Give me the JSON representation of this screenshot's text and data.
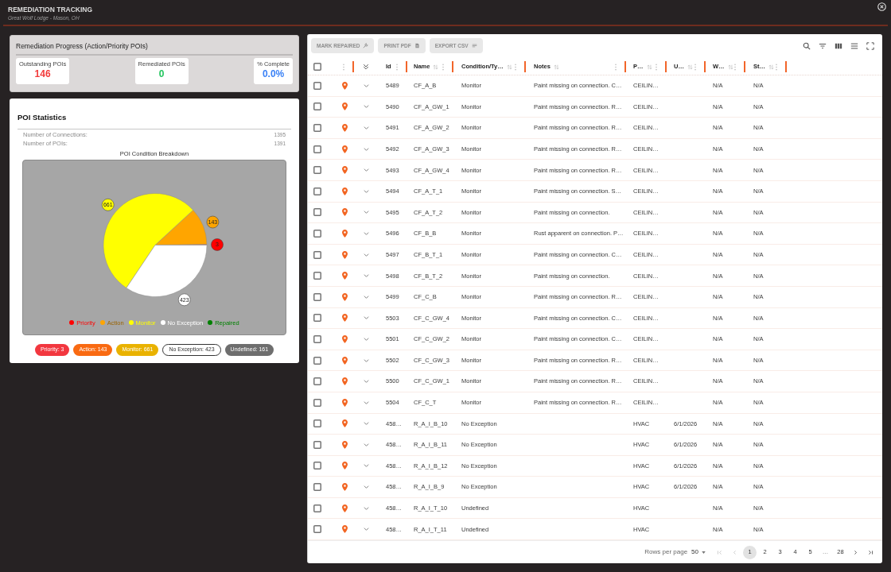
{
  "header": {
    "title": "REMEDIATION TRACKING",
    "subtitle": "Great Wolf Lodge - Mason, OH"
  },
  "progress_panel": {
    "title": "Remediation Progress (Action/Priority POIs)",
    "stats": [
      {
        "label": "Outstanding POIs",
        "value": "146",
        "color": "#f23b3b"
      },
      {
        "label": "Remediated POIs",
        "value": "0",
        "color": "#22c55e"
      },
      {
        "label": "% Complete",
        "value": "0.0%",
        "color": "#3b82f6"
      }
    ]
  },
  "statistics_panel": {
    "title": "POI Statistics",
    "rows": [
      {
        "label": "Number of Connections:",
        "value": "1395"
      },
      {
        "label": "Number of POIs:",
        "value": "1391"
      }
    ],
    "chart_data": {
      "type": "pie",
      "title": "POI Condition Breakdown",
      "categories": [
        "Priority",
        "Action",
        "Monitor",
        "No Exception",
        "Repaired"
      ],
      "values": [
        3,
        143,
        661,
        423,
        0
      ],
      "colors": [
        "#ff0000",
        "#ffa500",
        "#ffff00",
        "#ffffff",
        "#008000"
      ],
      "data_labels": true,
      "legend": "bottom"
    },
    "badges": [
      {
        "label": "Priority: 3",
        "kind": "filled",
        "color": "#f2373f"
      },
      {
        "label": "Action: 143",
        "kind": "filled",
        "color": "#f96a12"
      },
      {
        "label": "Monitor: 661",
        "kind": "filled",
        "color": "#e9b200"
      },
      {
        "label": "No Exception: 423",
        "kind": "outlined",
        "color": "#ffffff"
      },
      {
        "label": "Undefined: 161",
        "kind": "filled",
        "color": "#6e6e6e"
      }
    ]
  },
  "toolbar": {
    "buttons": [
      {
        "label": "MARK REPAIRED",
        "disabled": true
      },
      {
        "label": "PRINT PDF",
        "disabled": true
      },
      {
        "label": "EXPORT CSV",
        "disabled": true
      }
    ]
  },
  "table": {
    "all_checked": false,
    "columns": [
      {
        "label": "Id",
        "sortable": false
      },
      {
        "label": "Name",
        "sortable": true
      },
      {
        "label": "Condition/Ty…",
        "sortable": true
      },
      {
        "label": "Notes",
        "sortable": true
      },
      {
        "label": "P…",
        "sortable": true
      },
      {
        "label": "U…",
        "sortable": true
      },
      {
        "label": "W…",
        "sortable": true
      },
      {
        "label": "St…",
        "sortable": true
      }
    ],
    "rows": [
      {
        "checked": false,
        "expanded": false,
        "id": "5489",
        "name": "CF_A_B",
        "condition": "Monitor",
        "notes": "Paint missing on connection. C…",
        "column_5": "CEILIN…",
        "column_7": "N/A",
        "column_8": "N/A"
      },
      {
        "checked": false,
        "expanded": false,
        "id": "5490",
        "name": "CF_A_GW_1",
        "condition": "Monitor",
        "notes": "Paint missing on connection. R…",
        "column_5": "CEILIN…",
        "column_7": "N/A",
        "column_8": "N/A"
      },
      {
        "checked": false,
        "expanded": false,
        "id": "5491",
        "name": "CF_A_GW_2",
        "condition": "Monitor",
        "notes": "Paint missing on connection. R…",
        "column_5": "CEILIN…",
        "column_7": "N/A",
        "column_8": "N/A"
      },
      {
        "checked": false,
        "expanded": false,
        "id": "5492",
        "name": "CF_A_GW_3",
        "condition": "Monitor",
        "notes": "Paint missing on connection. R…",
        "column_5": "CEILIN…",
        "column_7": "N/A",
        "column_8": "N/A"
      },
      {
        "checked": false,
        "expanded": false,
        "id": "5493",
        "name": "CF_A_GW_4",
        "condition": "Monitor",
        "notes": "Paint missing on connection. R…",
        "column_5": "CEILIN…",
        "column_7": "N/A",
        "column_8": "N/A"
      },
      {
        "checked": false,
        "expanded": false,
        "id": "5494",
        "name": "CF_A_T_1",
        "condition": "Monitor",
        "notes": "Paint missing on connection. S…",
        "column_5": "CEILIN…",
        "column_7": "N/A",
        "column_8": "N/A"
      },
      {
        "checked": false,
        "expanded": false,
        "id": "5495",
        "name": "CF_A_T_2",
        "condition": "Monitor",
        "notes": "Paint missing on connection.",
        "column_5": "CEILIN…",
        "column_7": "N/A",
        "column_8": "N/A"
      },
      {
        "checked": false,
        "expanded": false,
        "id": "5496",
        "name": "CF_B_B",
        "condition": "Monitor",
        "notes": "Rust apparent on connection. P…",
        "column_5": "CEILIN…",
        "column_7": "N/A",
        "column_8": "N/A"
      },
      {
        "checked": false,
        "expanded": false,
        "id": "5497",
        "name": "CF_B_T_1",
        "condition": "Monitor",
        "notes": "Paint missing on connection. C…",
        "column_5": "CEILIN…",
        "column_7": "N/A",
        "column_8": "N/A"
      },
      {
        "checked": false,
        "expanded": false,
        "id": "5498",
        "name": "CF_B_T_2",
        "condition": "Monitor",
        "notes": "Paint missing on connection.",
        "column_5": "CEILIN…",
        "column_7": "N/A",
        "column_8": "N/A"
      },
      {
        "checked": false,
        "expanded": false,
        "id": "5499",
        "name": "CF_C_B",
        "condition": "Monitor",
        "notes": "Paint missing on connection. R…",
        "column_5": "CEILIN…",
        "column_7": "N/A",
        "column_8": "N/A"
      },
      {
        "checked": false,
        "expanded": false,
        "id": "5503",
        "name": "CF_C_GW_4",
        "condition": "Monitor",
        "notes": "Paint missing on connection. C…",
        "column_5": "CEILIN…",
        "column_7": "N/A",
        "column_8": "N/A"
      },
      {
        "checked": false,
        "expanded": false,
        "id": "5501",
        "name": "CF_C_GW_2",
        "condition": "Monitor",
        "notes": "Paint missing on connection. C…",
        "column_5": "CEILIN…",
        "column_7": "N/A",
        "column_8": "N/A"
      },
      {
        "checked": false,
        "expanded": false,
        "id": "5502",
        "name": "CF_C_GW_3",
        "condition": "Monitor",
        "notes": "Paint missing on connection. R…",
        "column_5": "CEILIN…",
        "column_7": "N/A",
        "column_8": "N/A"
      },
      {
        "checked": false,
        "expanded": false,
        "id": "5500",
        "name": "CF_C_GW_1",
        "condition": "Monitor",
        "notes": "Paint missing on connection. R…",
        "column_5": "CEILIN…",
        "column_7": "N/A",
        "column_8": "N/A"
      },
      {
        "checked": false,
        "expanded": false,
        "id": "5504",
        "name": "CF_C_T",
        "condition": "Monitor",
        "notes": "Paint missing on connection. R…",
        "column_5": "CEILIN…",
        "column_7": "N/A",
        "column_8": "N/A"
      },
      {
        "checked": false,
        "expanded": false,
        "id": "458…",
        "name": "R_A_I_B_10",
        "condition": "No Exception",
        "column_5": "HVAC",
        "column_6": "6/1/2026",
        "column_7": "N/A",
        "column_8": "N/A"
      },
      {
        "checked": false,
        "expanded": false,
        "id": "458…",
        "name": "R_A_I_B_11",
        "condition": "No Exception",
        "column_5": "HVAC",
        "column_6": "6/1/2026",
        "column_7": "N/A",
        "column_8": "N/A"
      },
      {
        "checked": false,
        "expanded": false,
        "id": "458…",
        "name": "R_A_I_B_12",
        "condition": "No Exception",
        "column_5": "HVAC",
        "column_6": "6/1/2026",
        "column_7": "N/A",
        "column_8": "N/A"
      },
      {
        "checked": false,
        "expanded": false,
        "id": "458…",
        "name": "R_A_I_B_9",
        "condition": "No Exception",
        "column_5": "HVAC",
        "column_6": "6/1/2026",
        "column_7": "N/A",
        "column_8": "N/A"
      },
      {
        "checked": false,
        "expanded": false,
        "id": "458…",
        "name": "R_A_I_T_10",
        "condition": "Undefined",
        "column_5": "HVAC",
        "column_7": "N/A",
        "column_8": "N/A"
      },
      {
        "checked": false,
        "expanded": false,
        "id": "458…",
        "name": "R_A_I_T_11",
        "condition": "Undefined",
        "column_5": "HVAC",
        "column_7": "N/A",
        "column_8": "N/A"
      }
    ]
  },
  "pagination": {
    "rows_per_page_label": "Rows per page",
    "rows_per_page": "50",
    "first_disabled": true,
    "prev_disabled": true,
    "next_disabled": false,
    "last_disabled": false,
    "pages": [
      {
        "label": "1",
        "kind": "page",
        "selected": true
      },
      {
        "label": "2",
        "kind": "page",
        "selected": false
      },
      {
        "label": "3",
        "kind": "page",
        "selected": false
      },
      {
        "label": "4",
        "kind": "page",
        "selected": false
      },
      {
        "label": "5",
        "kind": "page",
        "selected": false
      },
      {
        "label": "…",
        "kind": "gap",
        "selected": false
      },
      {
        "label": "28",
        "kind": "page",
        "selected": false
      }
    ]
  }
}
